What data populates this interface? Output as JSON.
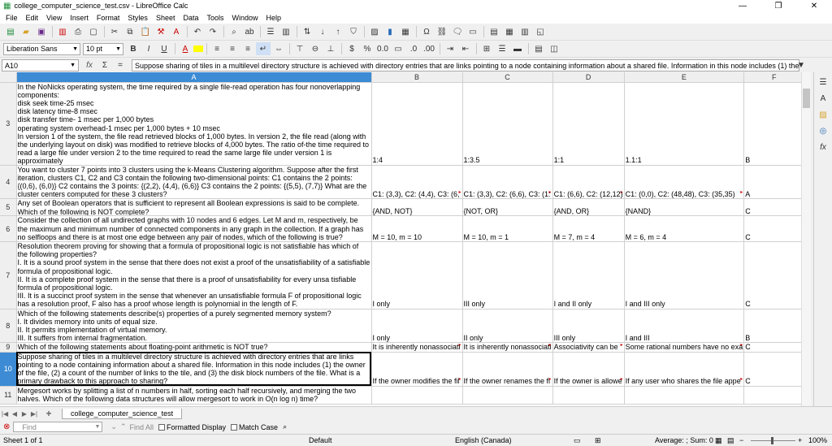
{
  "window": {
    "title": "college_computer_science_test.csv - LibreOffice Calc"
  },
  "menu": [
    "File",
    "Edit",
    "View",
    "Insert",
    "Format",
    "Styles",
    "Sheet",
    "Data",
    "Tools",
    "Window",
    "Help"
  ],
  "format_bar": {
    "font_name": "Liberation Sans",
    "font_size": "10 pt"
  },
  "formula_bar": {
    "name_box": "A10",
    "content": "Suppose sharing of tiles in a multilevel directory structure is achieved with directory entries that are links pointing to a node containing information about a shared file. Information in this node includes (1) the owner of the file, (2) a"
  },
  "columns": [
    "A",
    "B",
    "C",
    "D",
    "E",
    "F"
  ],
  "rows": [
    {
      "num": "3",
      "a": "In the NoNicks operating system, the time required by a single file-read operation has four nonoverlapping components:\ndisk seek time-25 msec\ndisk latency time-8 msec\ndisk transfer time- 1 msec per 1,000 bytes\noperating system overhead-1 msec per 1,000 bytes + 10 msec\nIn version 1 of the system, the file read retrieved blocks of 1,000 bytes. In version 2, the file read (along with the underlying layout on disk) was modified to retrieve blocks of 4,000 bytes. The ratio of-the time required to read a large file under version 2 to the time required to read the same large file under version 1 is approximately",
      "b": "1:4",
      "c": "1:3.5",
      "d": "1:1",
      "e": "1.1:1",
      "f": "B"
    },
    {
      "num": "4",
      "a": "You want to cluster 7 points into 3 clusters using the k-Means Clustering algorithm. Suppose after the first iteration, clusters C1, C2 and C3 contain the following two-dimensional points: C1 contains the 2 points: {(0,6), (6,0)} C2 contains the 3 points: {(2,2), (4,4), (6,6)} C3 contains the 2 points: {(5,5), (7,7)} What are the cluster centers computed for these 3 clusters?",
      "b": "C1: (3,3), C2: (4,4), C3: (6,",
      "c": "C1: (3,3), C2: (6,6), C3: (1:",
      "d": "C1: (6,6), C2: (12,12)",
      "e": "C1: (0,0), C2: (48,48), C3: (35,35)",
      "f": "A"
    },
    {
      "num": "5",
      "a": "Any set of Boolean operators that is sufficient to represent all Boolean expressions is said to be complete. Which of the following is NOT complete?",
      "b": "{AND, NOT}",
      "c": "{NOT, OR}",
      "d": "{AND, OR}",
      "e": "{NAND}",
      "f": "C"
    },
    {
      "num": "6",
      "a": "Consider the collection of all undirected graphs with 10 nodes and 6 edges. Let M and m, respectively, be the maximum and minimum number of connected components in any graph in the collection. If a graph has no selfloops and there is at most one edge between any pair of nodes, which of the following is true?",
      "b": "M = 10, m = 10",
      "c": "M = 10, m = 1",
      "d": "M = 7, m = 4",
      "e": "M = 6, m = 4",
      "f": "C"
    },
    {
      "num": "7",
      "a": "Resolution theorem proving for showing that a formula of propositional logic is not satisfiable has which of the following properties?\nI. It is a sound proof system in the sense that there does not exist a proof of the unsatisfiability of a satisfiable formula of propositional logic.\nII. It is a complete proof system in the sense that there is a proof of unsatisfiability for every unsa tisfiable formula of propositional logic.\nIII. It is a succinct proof system in the sense that whenever an unsatisfiable formula F of propositional logic has a resolution proof, F also has a proof whose length is polynomial in the length of F.",
      "b": "I only",
      "c": "III only",
      "d": "I and II only",
      "e": "I and III only",
      "f": "C"
    },
    {
      "num": "8",
      "a": "Which of the following statements describe(s) properties of a purely segmented memory system?\nI. It divides memory into units of equal size.\nII. It permits implementation of virtual memory.\nIII. It suffers from internal fragmentation.",
      "b": "I only",
      "c": "II only",
      "d": "III only",
      "e": "I and III",
      "f": "B"
    },
    {
      "num": "9",
      "a": "Which of the following statements about floating-point arithmetic is NOT true?",
      "b": "It is inherently nonassociati",
      "c": "It is inherently nonassociati",
      "d": "Associativity can be",
      "e": "Some rational numbers have no exa",
      "f": "C"
    },
    {
      "num": "10",
      "a": "Suppose sharing of tiles in a multilevel directory structure is achieved with directory entries that are links pointing to a node containing information about a shared file. Information in this node includes (1) the owner of the file, (2) a count of the number of links to the tile, and (3) the disk block numbers of the file. What is a primary drawback to this approach to sharing?",
      "b": "If the owner modifies the fil",
      "c": "If the owner renames the fi",
      "d": "If the owner is allowe",
      "e": "If any user who shares the file appe",
      "f": "C"
    },
    {
      "num": "11",
      "a": "Mergesort works by splitting a list of n numbers in half, sorting each half recursively, and merging the two halves. Which of the following data structures will allow mergesort to work in O(n log n) time?",
      "b": "",
      "c": "",
      "d": "",
      "e": "",
      "f": ""
    }
  ],
  "sheet_tab": "college_computer_science_test",
  "findbar": {
    "placeholder": "Find",
    "find_all": "Find All",
    "formatted_display": "Formatted Display",
    "match_case": "Match Case"
  },
  "status": {
    "sheet": "Sheet 1 of 1",
    "style": "Default",
    "language": "English (Canada)",
    "summary": "Average: ; Sum: 0",
    "zoom": "100%"
  }
}
